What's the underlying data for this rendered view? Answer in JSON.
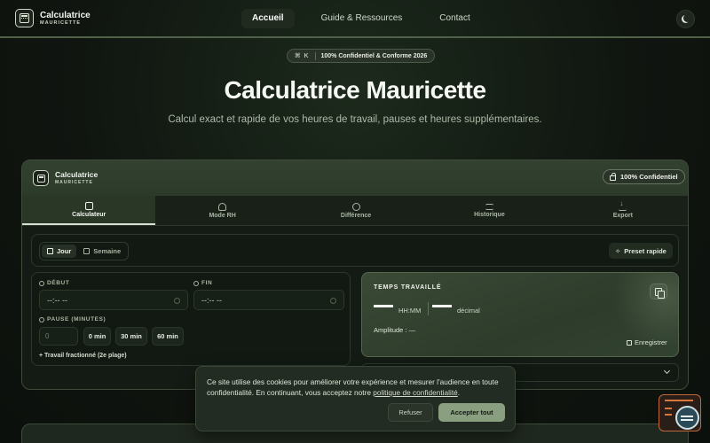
{
  "brand": {
    "name": "Calculatrice",
    "tagline": "MAURICETTE"
  },
  "nav": {
    "links": [
      "Accueil",
      "Guide & Ressources",
      "Contact"
    ],
    "active": "Accueil"
  },
  "hero": {
    "badge_kbd": "⌘ K",
    "badge_text": "100% Confidentiel & Conforme 2026",
    "title": "Calculatrice Mauricette",
    "subtitle": "Calcul exact et rapide de vos heures de travail, pauses et heures supplémentaires."
  },
  "card": {
    "brand_name": "Calculatrice",
    "brand_tagline": "MAURICETTE",
    "confidential": "100% Confidentiel",
    "tabs": [
      {
        "label": "Calculateur",
        "icon": "calendar-icon"
      },
      {
        "label": "Mode RH",
        "icon": "people-icon"
      },
      {
        "label": "Différence",
        "icon": "clock-icon"
      },
      {
        "label": "Historique",
        "icon": "list-icon"
      },
      {
        "label": "Export",
        "icon": "download-icon"
      }
    ],
    "modes": [
      "Jour",
      "Semaine"
    ],
    "preset": "Preset rapide",
    "start_label": "DÉBUT",
    "end_label": "FIN",
    "start_value": "--:-- --",
    "end_value": "--:-- --",
    "pause_label": "PAUSE (MINUTES)",
    "pause_placeholder": "0",
    "pause_chips": [
      "0 min",
      "30 min",
      "60 min"
    ],
    "fractionated": "+  Travail fractionné (2e plage)"
  },
  "result": {
    "title": "TEMPS TRAVAILLÉ",
    "unit_hhmm": "HH:MM",
    "unit_decimal": "décimal",
    "amplitude": "Amplitude : —",
    "save": "Enregistrer"
  },
  "cookie": {
    "text_before": "Ce site utilise des cookies pour améliorer votre expérience et mesurer l'audience en toute confidentialité. En continuant, vous acceptez notre ",
    "link": "politique de confidentialité",
    "text_after": ".",
    "refuse": "Refuser",
    "accept": "Accepter tout"
  },
  "colors": {
    "accent": "#8a9e80",
    "background": "#101510",
    "card_header": "#334131",
    "widget_border": "#c2673a"
  }
}
